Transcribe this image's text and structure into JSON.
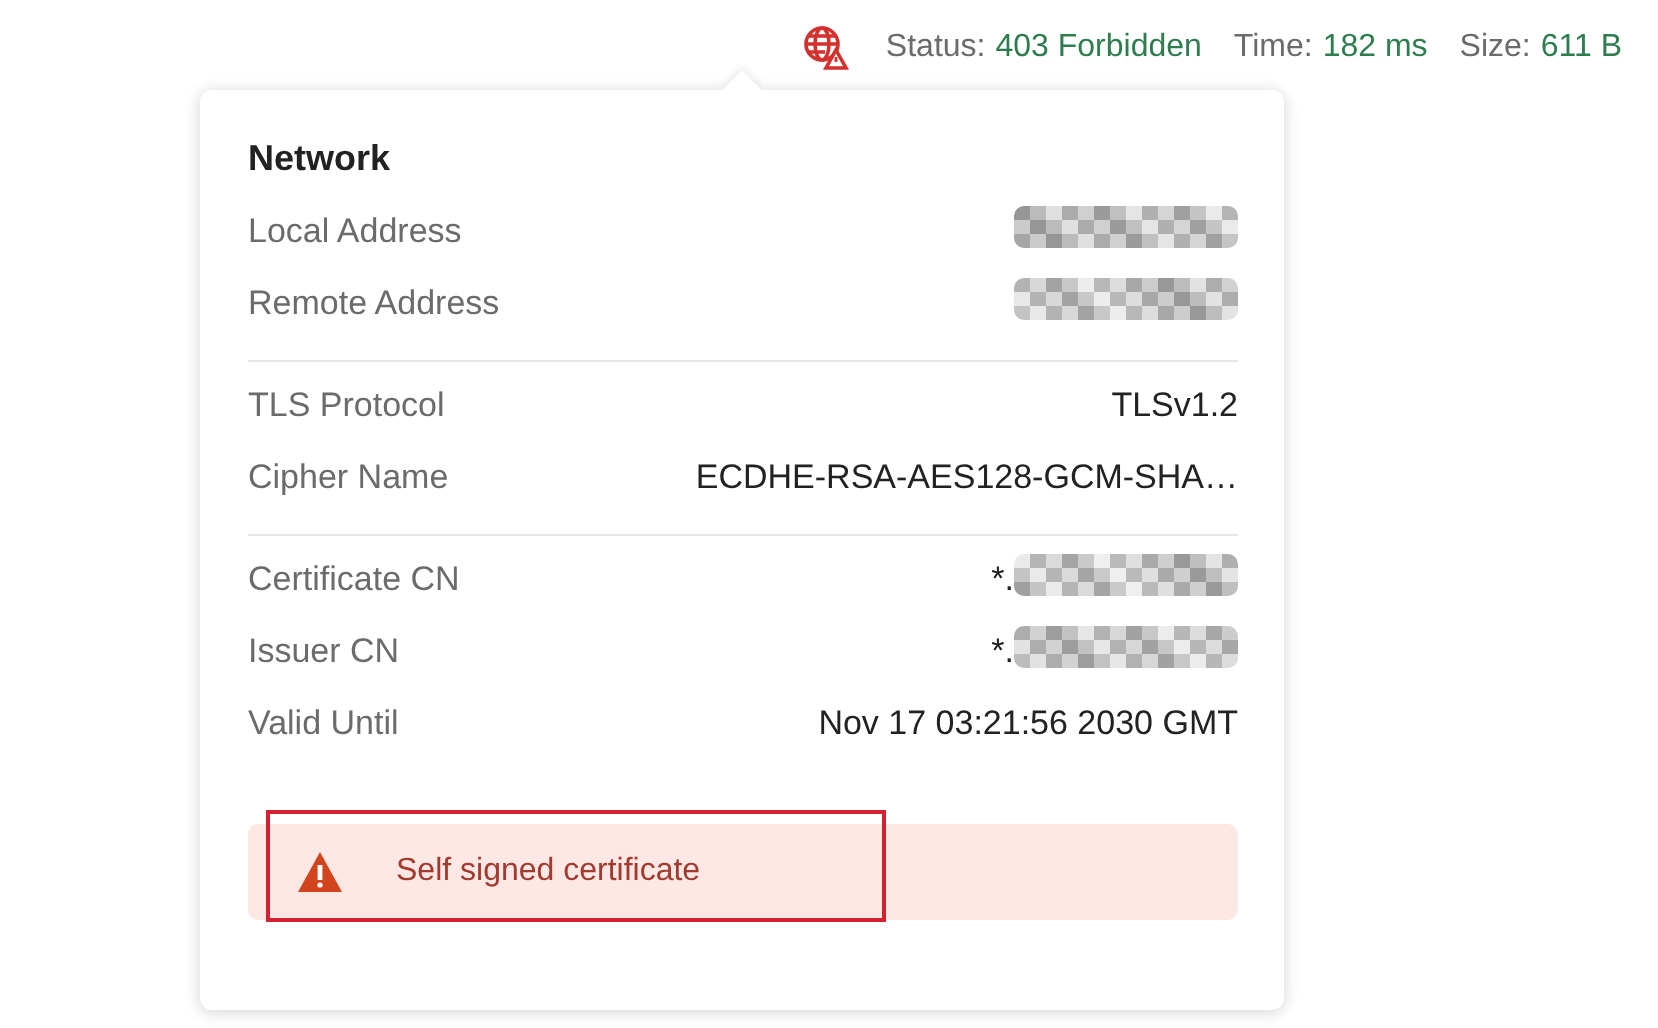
{
  "status_bar": {
    "items": [
      {
        "label": "Status:",
        "value": "403 Forbidden"
      },
      {
        "label": "Time:",
        "value": "182 ms"
      },
      {
        "label": "Size:",
        "value": "611 B"
      }
    ]
  },
  "network_popover": {
    "title": "Network",
    "sections": [
      {
        "rows": [
          {
            "label": "Local Address",
            "redacted": true
          },
          {
            "label": "Remote Address",
            "redacted": true
          }
        ]
      },
      {
        "rows": [
          {
            "label": "TLS Protocol",
            "value": "TLSv1.2"
          },
          {
            "label": "Cipher Name",
            "value": "ECDHE-RSA-AES128-GCM-SHA…"
          }
        ]
      },
      {
        "rows": [
          {
            "label": "Certificate CN",
            "value": "*.",
            "redacted": true
          },
          {
            "label": "Issuer CN",
            "value": "*.",
            "redacted": true
          },
          {
            "label": "Valid Until",
            "value": "Nov 17 03:21:56 2030 GMT"
          }
        ]
      }
    ],
    "warning": {
      "message": "Self signed certificate",
      "highlighted": true
    }
  }
}
